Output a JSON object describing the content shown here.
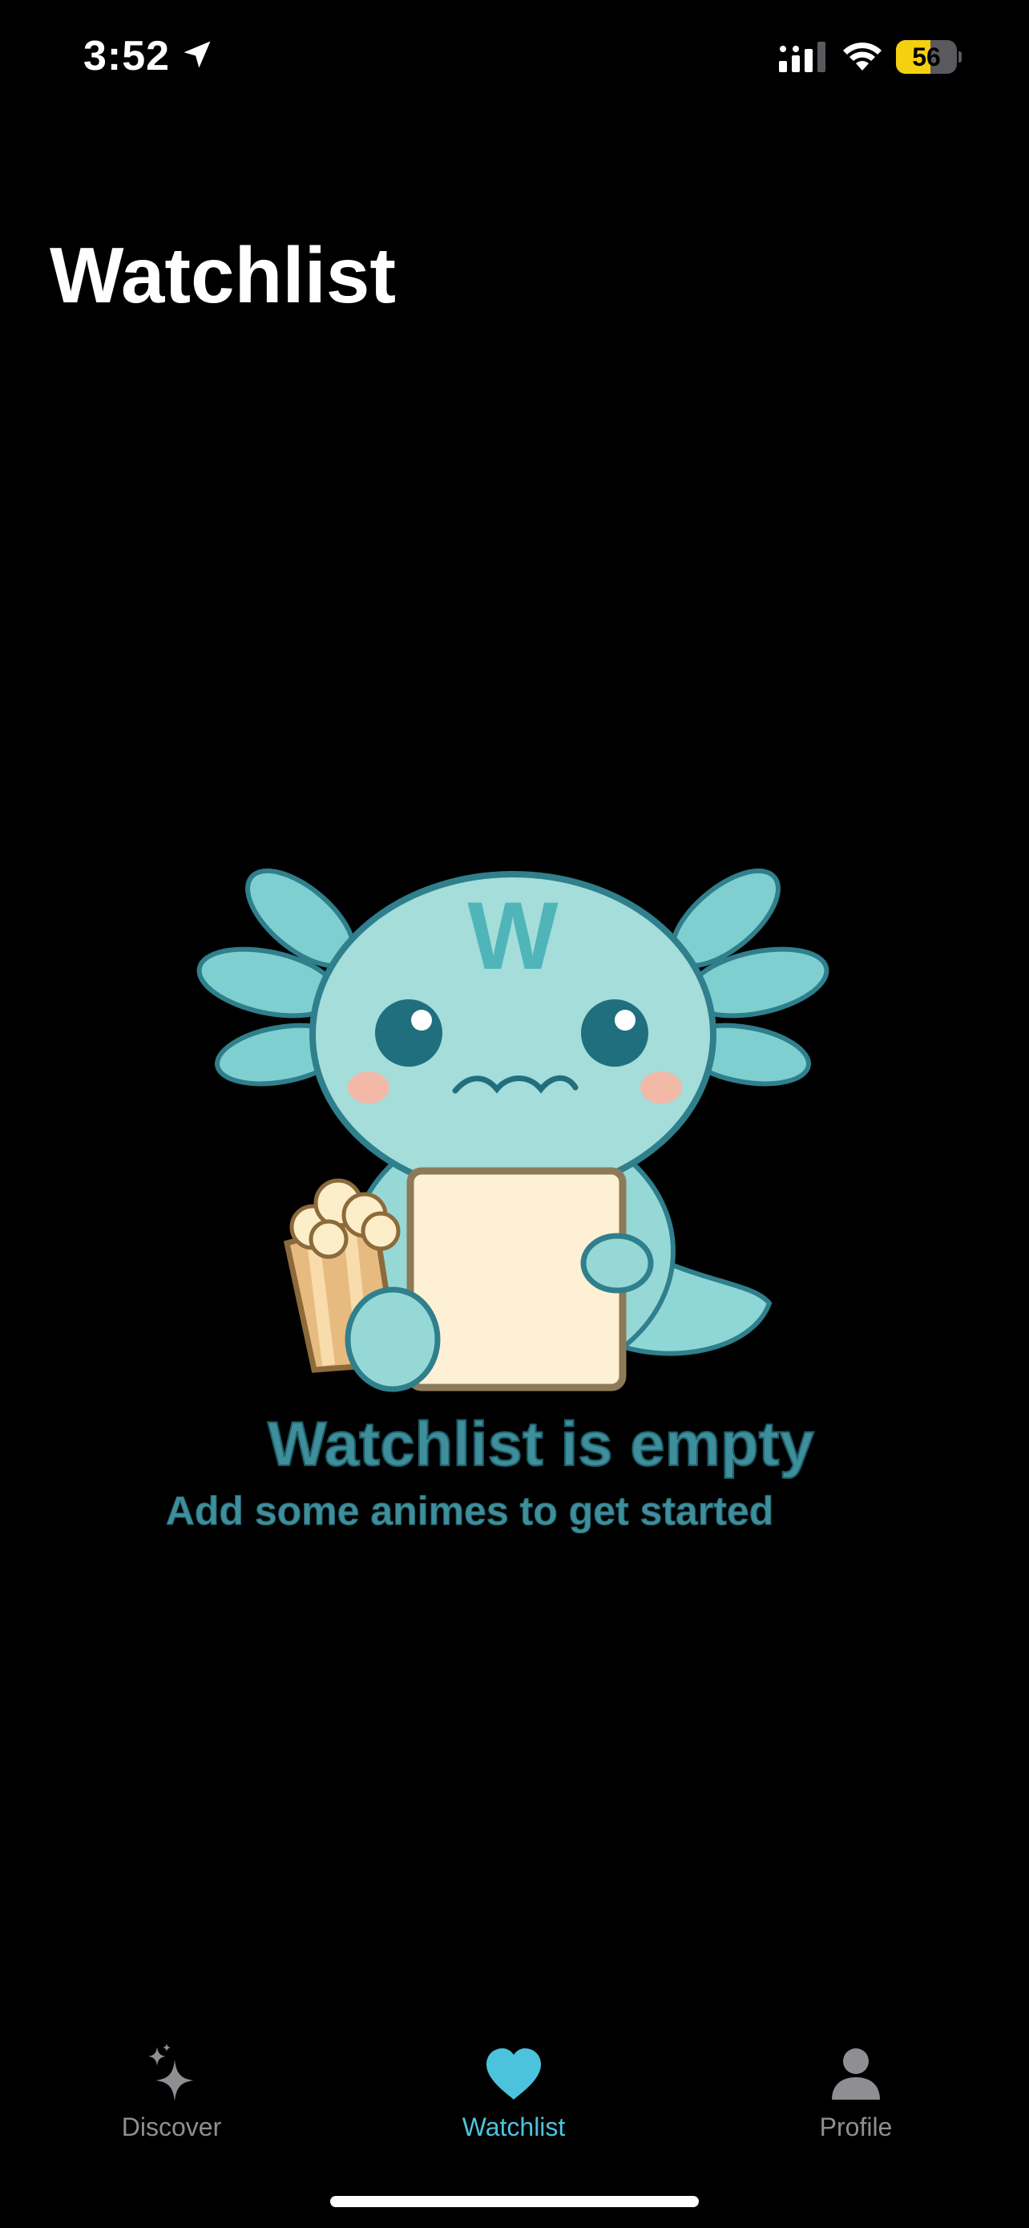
{
  "status_bar": {
    "time": "3:52",
    "battery_level": "56",
    "battery_fraction": 0.56,
    "icons": [
      "location-arrow-icon",
      "signal-icon",
      "wifi-icon",
      "battery-icon"
    ]
  },
  "header": {
    "title": "Watchlist"
  },
  "empty_state": {
    "illustration": "axolotl-mascot-with-popcorn-and-board",
    "mascot_letter": "W",
    "title": "Watchlist is empty",
    "subtitle": "Add some animes to get started"
  },
  "tab_bar": {
    "selected": "watchlist",
    "tabs": [
      {
        "id": "discover",
        "label": "Discover",
        "icon": "sparkles-icon"
      },
      {
        "id": "watchlist",
        "label": "Watchlist",
        "icon": "heart-icon"
      },
      {
        "id": "profile",
        "label": "Profile",
        "icon": "person-icon"
      }
    ]
  },
  "colors": {
    "background": "#000000",
    "accent": "#4cc3dd",
    "inactive": "#8e8e93",
    "empty_text": "#3e8e9b",
    "battery_fill": "#f5d00f"
  }
}
